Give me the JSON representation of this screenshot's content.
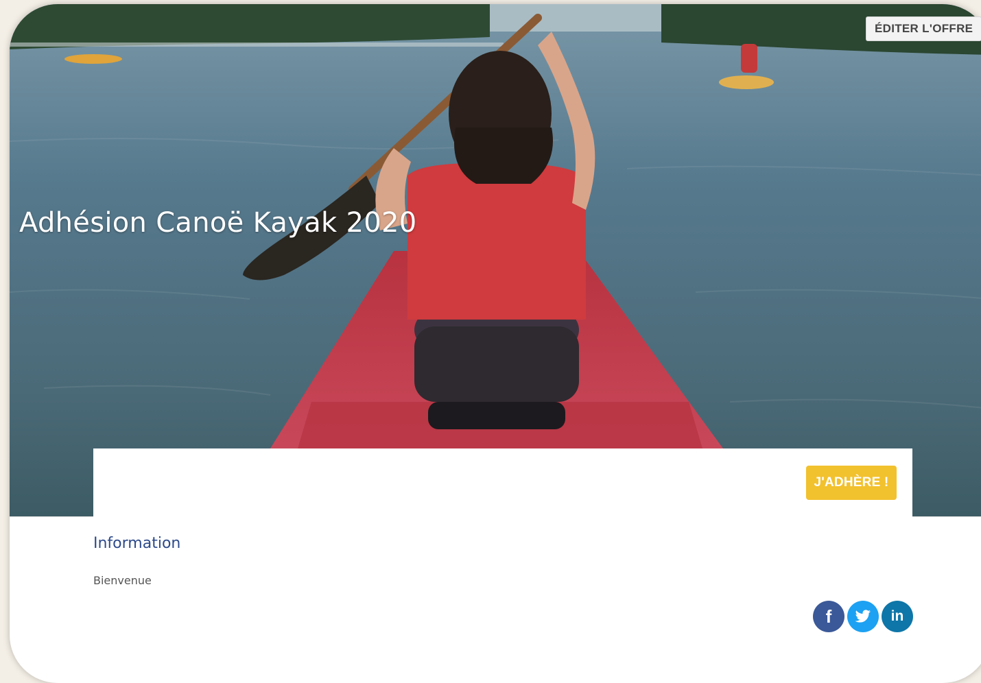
{
  "hero": {
    "title": "Adhésion Canoë Kayak 2020"
  },
  "toolbar": {
    "edit_offer_label": "ÉDITER L'OFFRE"
  },
  "actions": {
    "join_label": "J'ADHÈRE !"
  },
  "info": {
    "heading": "Information",
    "text": "Bienvenue"
  },
  "social": [
    {
      "name": "facebook",
      "glyph": "f",
      "icon": "facebook-icon"
    },
    {
      "name": "twitter",
      "glyph": "",
      "icon": "twitter-icon"
    },
    {
      "name": "linkedin",
      "glyph": "in",
      "icon": "linkedin-icon"
    }
  ],
  "colors": {
    "accent": "#f2c12e",
    "heading": "#2d4a8a",
    "facebook": "#3b5998",
    "twitter": "#1da1f2",
    "linkedin": "#0e76a8"
  }
}
